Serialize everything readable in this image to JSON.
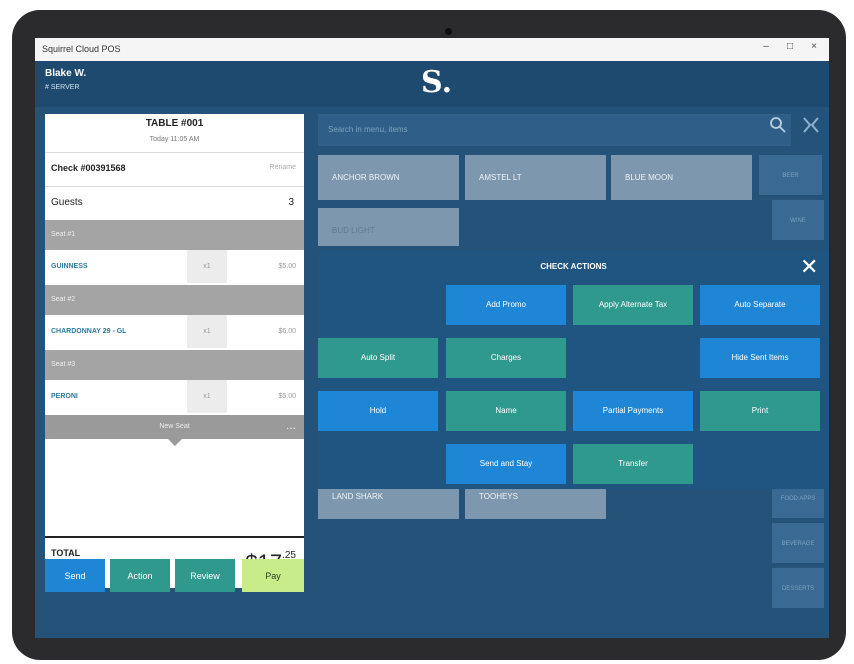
{
  "window": {
    "title": "Squirrel Cloud POS",
    "minimize": "–",
    "maximize": "□",
    "close": "×"
  },
  "header": {
    "user_name": "Blake W.",
    "user_role": "# SERVER",
    "logo": "S."
  },
  "check": {
    "table_title": "TABLE #001",
    "date": "Today 11:05 AM",
    "check_number": "Check #00391568",
    "rename_label": "Rename",
    "guests_label": "Guests",
    "guests_count": "3",
    "lines": [
      {
        "seat": "Seat #1",
        "item": "GUINNESS",
        "qty": "x1",
        "price": "$5.00"
      },
      {
        "seat": "Seat #2",
        "item": "CHARDONNAY 29 - GL",
        "qty": "x1",
        "price": "$6.00"
      },
      {
        "seat": "Seat #3",
        "item": "PERONI",
        "qty": "x1",
        "price": "$5.00"
      }
    ],
    "more_label": "New Seat",
    "more_dots": "...",
    "total_label": "TOTAL",
    "total_dollars": "$17",
    "total_cents": ".25"
  },
  "bottom_buttons": {
    "send": "Send",
    "action": "Action",
    "review": "Review",
    "pay": "Pay"
  },
  "search": {
    "placeholder": "Search in menu, items",
    "search_icon": "search-icon",
    "collapse_icon": "collapse-icon"
  },
  "products": [
    {
      "label": "ANCHOR BROWN"
    },
    {
      "label": "AMSTEL LT"
    },
    {
      "label": "BLUE MOON"
    },
    {
      "label": "BUD LIGHT"
    },
    {
      "label": "LAND SHARK"
    },
    {
      "label": "TOOHEYS"
    }
  ],
  "right_column": [
    "BEER",
    "WINE",
    "FOOD APPS",
    "BEVERAGE",
    "DESSERTS"
  ],
  "modal": {
    "title": "CHECK ACTIONS",
    "close": "✕",
    "buttons": {
      "add_promo": "Add Promo",
      "apply_alternate_tax": "Apply Alternate Tax",
      "auto_separate": "Auto Separate",
      "auto_split": "Auto Split",
      "charges": "Charges",
      "hide_sent_items": "Hide Sent Items",
      "hold": "Hold",
      "name": "Name",
      "partial_payments": "Partial Payments",
      "print": "Print",
      "send_and_stay": "Send and Stay",
      "transfer": "Transfer"
    }
  },
  "colors": {
    "accent_blue": "#1f86d6",
    "accent_teal": "#30998e",
    "pay_green": "#c9ec8b",
    "background": "#245279"
  }
}
